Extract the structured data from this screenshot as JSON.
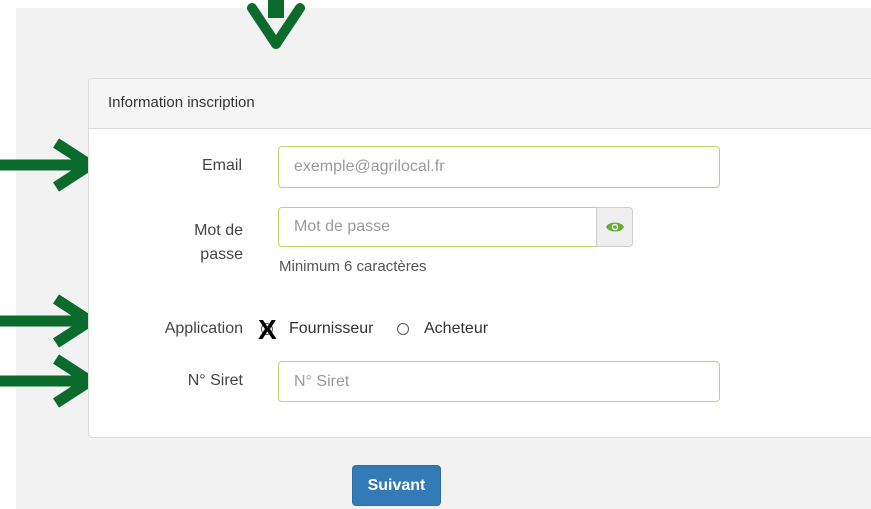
{
  "panel": {
    "title": "Information inscription"
  },
  "form": {
    "email": {
      "label": "Email",
      "placeholder": "exemple@agrilocal.fr",
      "value": ""
    },
    "password": {
      "label_line1": "Mot de",
      "label_line2": "passe",
      "placeholder": "Mot de passe",
      "value": "",
      "help": "Minimum 6 caractères",
      "toggle_icon": "eye-icon"
    },
    "application": {
      "label": "Application",
      "options": [
        {
          "label": "Fournisseur",
          "selected": true
        },
        {
          "label": "Acheteur",
          "selected": false
        }
      ],
      "annotation_mark": "X"
    },
    "siret": {
      "label": "N° Siret",
      "placeholder": "N° Siret",
      "value": ""
    }
  },
  "actions": {
    "next_label": "Suivant"
  },
  "annotations": {
    "arrow_color": "#0b6b2c"
  },
  "colors": {
    "input_border": "#b8d66a",
    "eye_icon": "#6aab2e",
    "primary_button": "#337ab7"
  }
}
